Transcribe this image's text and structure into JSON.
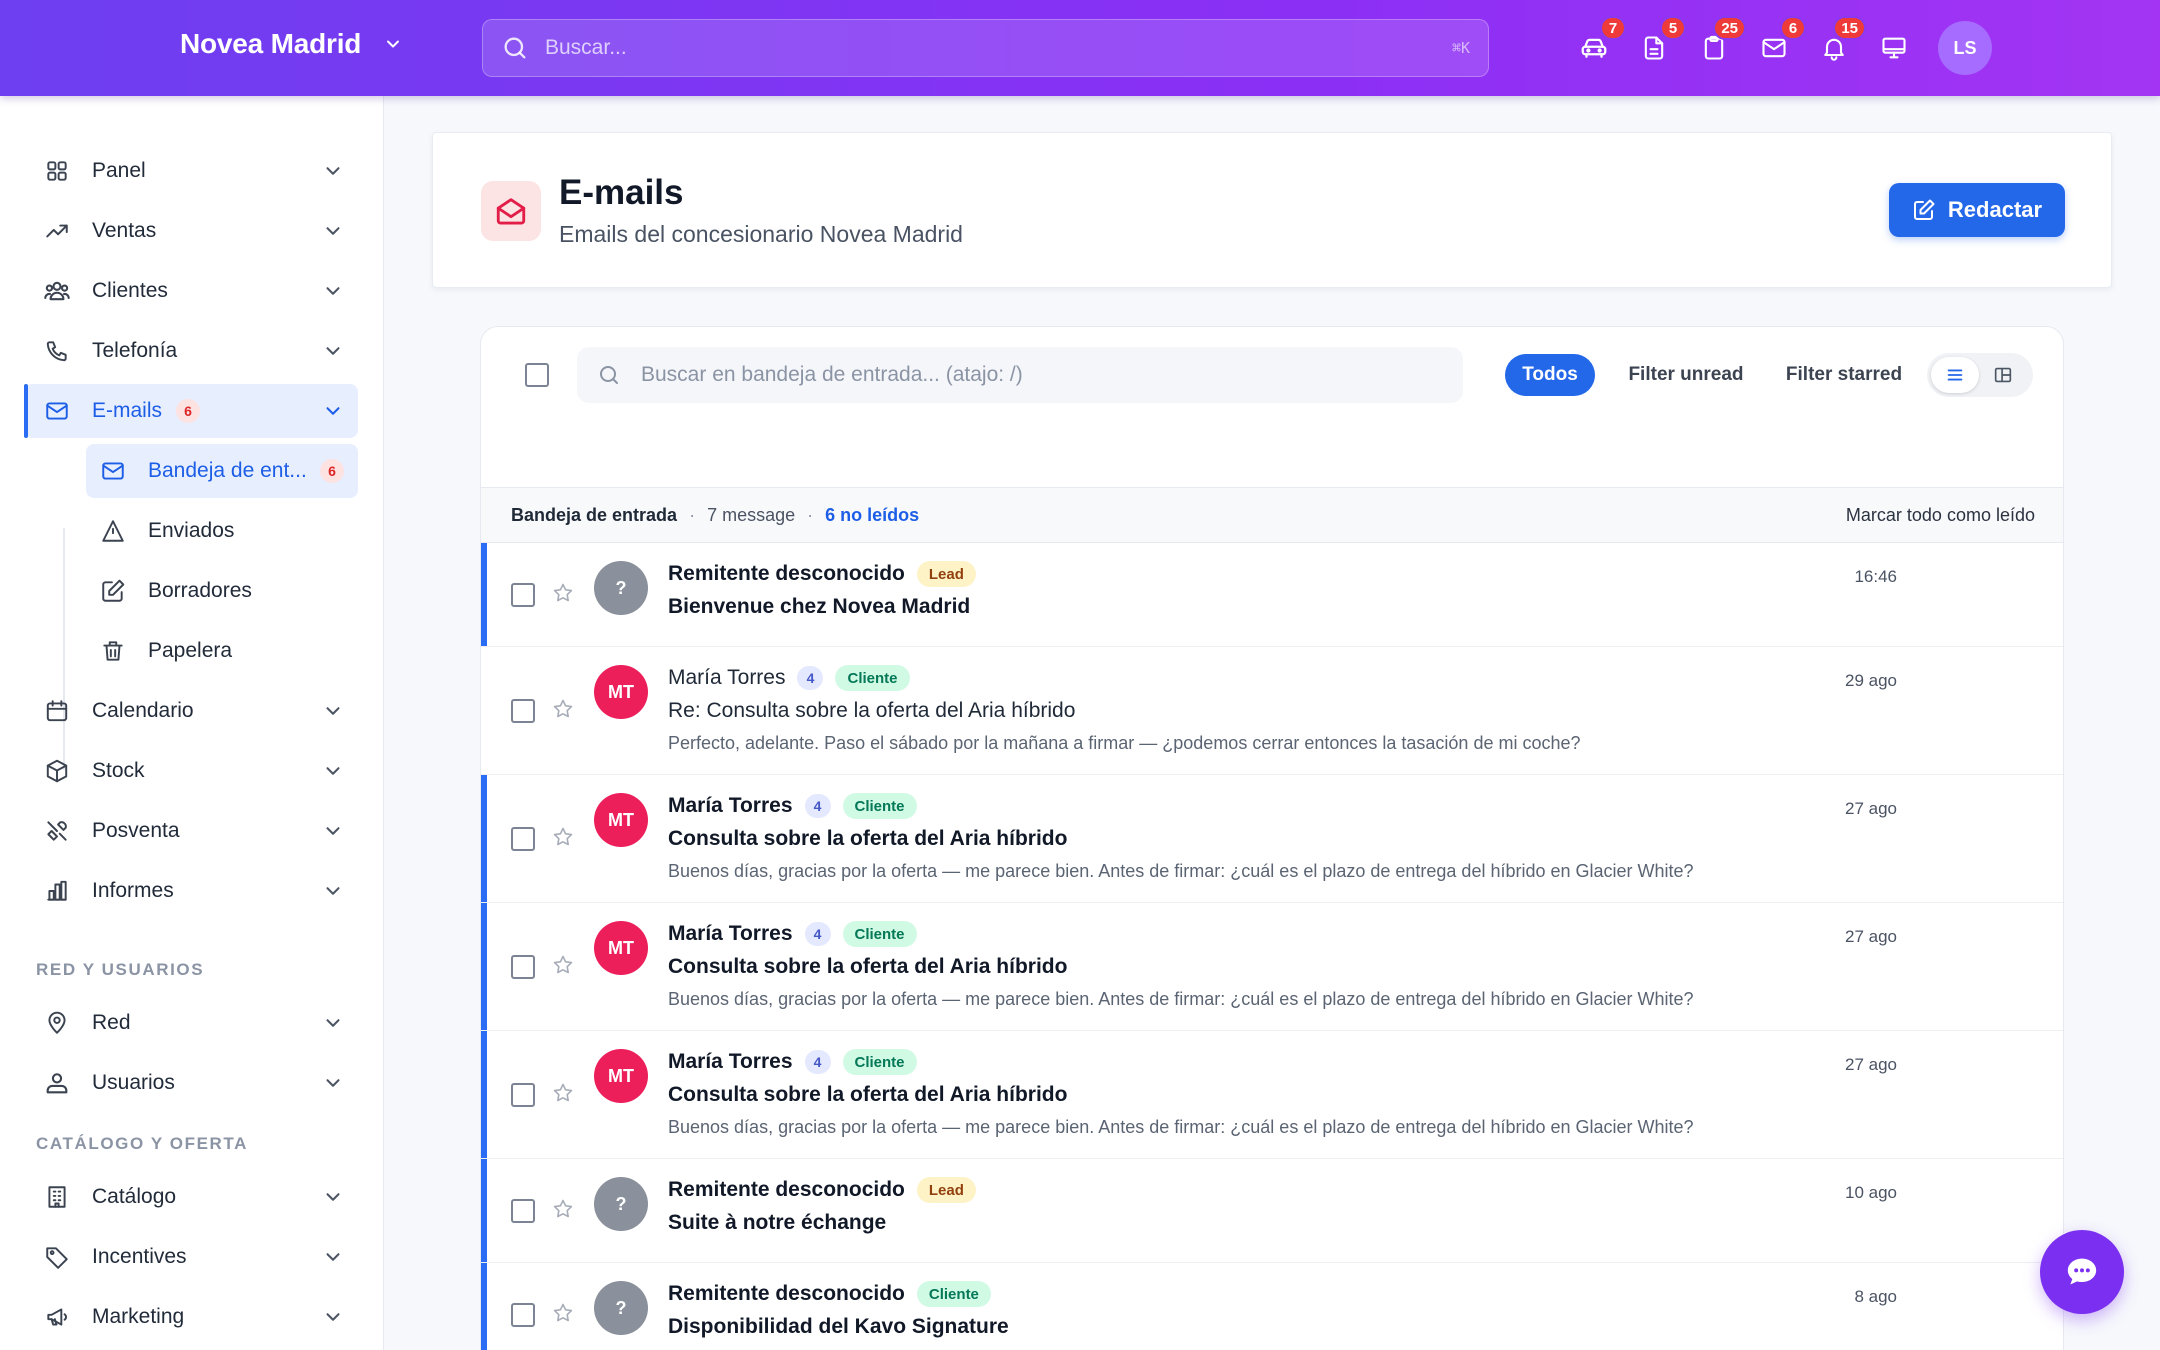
{
  "topbar": {
    "brand": "Novea Madrid",
    "search_placeholder": "Buscar...",
    "search_shortcut": "⌘K",
    "icons": [
      {
        "icon": "car-icon",
        "badge": "7"
      },
      {
        "icon": "document-icon",
        "badge": "5"
      },
      {
        "icon": "clipboard-icon",
        "badge": "25"
      },
      {
        "icon": "mail-icon",
        "badge": "6"
      },
      {
        "icon": "bell-icon",
        "badge": "15"
      },
      {
        "icon": "monitor-icon",
        "badge": ""
      }
    ],
    "avatar": "LS"
  },
  "sidebar": {
    "items": [
      {
        "label": "Panel"
      },
      {
        "label": "Ventas"
      },
      {
        "label": "Clientes"
      },
      {
        "label": "Telefonía"
      },
      {
        "label": "E-mails",
        "count": "6"
      },
      {
        "label": "Calendario"
      },
      {
        "label": "Stock"
      },
      {
        "label": "Posventa"
      },
      {
        "label": "Informes"
      }
    ],
    "sub_items": [
      {
        "label": "Bandeja de ent...",
        "count": "6"
      },
      {
        "label": "Enviados"
      },
      {
        "label": "Borradores"
      },
      {
        "label": "Papelera"
      }
    ],
    "section_network": "RED Y USUARIOS",
    "network_items": [
      {
        "label": "Red"
      },
      {
        "label": "Usuarios"
      }
    ],
    "section_catalog": "CATÁLOGO Y OFERTA",
    "catalog_items": [
      {
        "label": "Catálogo"
      },
      {
        "label": "Incentives"
      },
      {
        "label": "Marketing"
      }
    ]
  },
  "header": {
    "title": "E-mails",
    "subtitle": "Emails del concesionario Novea Madrid",
    "compose_label": "Redactar"
  },
  "inbox": {
    "search_placeholder": "Buscar en bandeja de entrada... (atajo: /)",
    "filters": {
      "all": "Todos",
      "unread": "Filter unread",
      "starred": "Filter starred"
    },
    "status": {
      "folder": "Bandeja de entrada",
      "sep": "·",
      "count": "7 message",
      "unread": "6 no leídos",
      "mark_all": "Marcar todo como leído"
    },
    "messages": [
      {
        "initials": "?",
        "sender": "Remitente desconocido",
        "num": "",
        "tag": "Lead",
        "subject": "Bienvenue chez Novea Madrid",
        "preview": "",
        "time": "16:46",
        "unread": true
      },
      {
        "initials": "MT",
        "sender": "María Torres",
        "num": "4",
        "tag": "Cliente",
        "subject": "Re: Consulta sobre la oferta del Aria híbrido",
        "preview": "Perfecto, adelante. Paso el sábado por la mañana a firmar — ¿podemos cerrar entonces la tasación de mi coche?",
        "time": "29 ago",
        "unread": false
      },
      {
        "initials": "MT",
        "sender": "María Torres",
        "num": "4",
        "tag": "Cliente",
        "subject": "Consulta sobre la oferta del Aria híbrido",
        "preview": "Buenos días, gracias por la oferta — me parece bien. Antes de firmar: ¿cuál es el plazo de entrega del híbrido en Glacier White?",
        "time": "27 ago",
        "unread": true
      },
      {
        "initials": "MT",
        "sender": "María Torres",
        "num": "4",
        "tag": "Cliente",
        "subject": "Consulta sobre la oferta del Aria híbrido",
        "preview": "Buenos días, gracias por la oferta — me parece bien. Antes de firmar: ¿cuál es el plazo de entrega del híbrido en Glacier White?",
        "time": "27 ago",
        "unread": true
      },
      {
        "initials": "MT",
        "sender": "María Torres",
        "num": "4",
        "tag": "Cliente",
        "subject": "Consulta sobre la oferta del Aria híbrido",
        "preview": "Buenos días, gracias por la oferta — me parece bien. Antes de firmar: ¿cuál es el plazo de entrega del híbrido en Glacier White?",
        "time": "27 ago",
        "unread": true
      },
      {
        "initials": "?",
        "sender": "Remitente desconocido",
        "num": "",
        "tag": "Lead",
        "subject": "Suite à notre échange",
        "preview": "",
        "time": "10 ago",
        "unread": true
      },
      {
        "initials": "?",
        "sender": "Remitente desconocido",
        "num": "",
        "tag": "Cliente",
        "subject": "Disponibilidad del Kavo Signature",
        "preview": "",
        "time": "8 ago",
        "unread": true
      }
    ]
  },
  "colors": {
    "brand_start": "#6d3ff0",
    "brand_end": "#a334f3",
    "accent_blue": "#2468ea",
    "unread_bar": "#2a6df4",
    "avatar_pink": "#ec1f5a"
  }
}
